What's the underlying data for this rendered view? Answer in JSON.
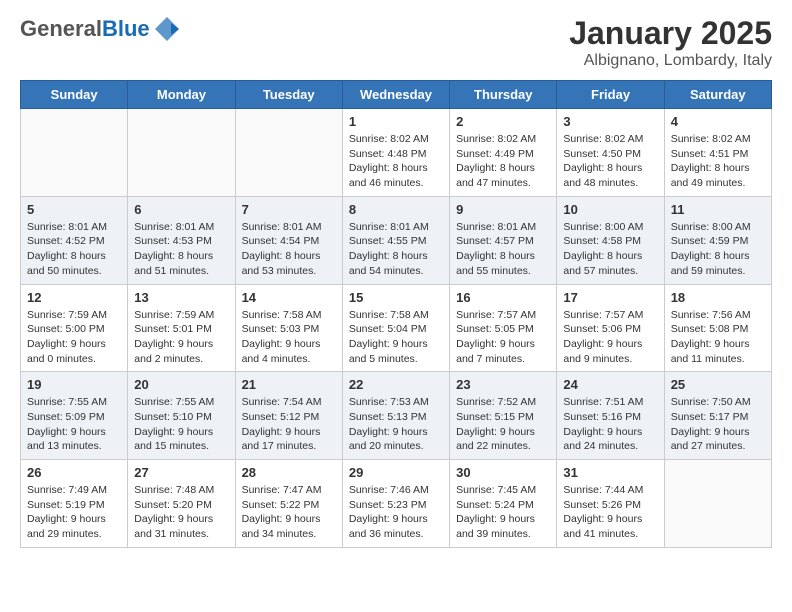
{
  "header": {
    "logo_general": "General",
    "logo_blue": "Blue",
    "month_title": "January 2025",
    "location": "Albignano, Lombardy, Italy"
  },
  "days_of_week": [
    "Sunday",
    "Monday",
    "Tuesday",
    "Wednesday",
    "Thursday",
    "Friday",
    "Saturday"
  ],
  "weeks": [
    [
      {
        "day": "",
        "info": ""
      },
      {
        "day": "",
        "info": ""
      },
      {
        "day": "",
        "info": ""
      },
      {
        "day": "1",
        "info": "Sunrise: 8:02 AM\nSunset: 4:48 PM\nDaylight: 8 hours and 46 minutes."
      },
      {
        "day": "2",
        "info": "Sunrise: 8:02 AM\nSunset: 4:49 PM\nDaylight: 8 hours and 47 minutes."
      },
      {
        "day": "3",
        "info": "Sunrise: 8:02 AM\nSunset: 4:50 PM\nDaylight: 8 hours and 48 minutes."
      },
      {
        "day": "4",
        "info": "Sunrise: 8:02 AM\nSunset: 4:51 PM\nDaylight: 8 hours and 49 minutes."
      }
    ],
    [
      {
        "day": "5",
        "info": "Sunrise: 8:01 AM\nSunset: 4:52 PM\nDaylight: 8 hours and 50 minutes."
      },
      {
        "day": "6",
        "info": "Sunrise: 8:01 AM\nSunset: 4:53 PM\nDaylight: 8 hours and 51 minutes."
      },
      {
        "day": "7",
        "info": "Sunrise: 8:01 AM\nSunset: 4:54 PM\nDaylight: 8 hours and 53 minutes."
      },
      {
        "day": "8",
        "info": "Sunrise: 8:01 AM\nSunset: 4:55 PM\nDaylight: 8 hours and 54 minutes."
      },
      {
        "day": "9",
        "info": "Sunrise: 8:01 AM\nSunset: 4:57 PM\nDaylight: 8 hours and 55 minutes."
      },
      {
        "day": "10",
        "info": "Sunrise: 8:00 AM\nSunset: 4:58 PM\nDaylight: 8 hours and 57 minutes."
      },
      {
        "day": "11",
        "info": "Sunrise: 8:00 AM\nSunset: 4:59 PM\nDaylight: 8 hours and 59 minutes."
      }
    ],
    [
      {
        "day": "12",
        "info": "Sunrise: 7:59 AM\nSunset: 5:00 PM\nDaylight: 9 hours and 0 minutes."
      },
      {
        "day": "13",
        "info": "Sunrise: 7:59 AM\nSunset: 5:01 PM\nDaylight: 9 hours and 2 minutes."
      },
      {
        "day": "14",
        "info": "Sunrise: 7:58 AM\nSunset: 5:03 PM\nDaylight: 9 hours and 4 minutes."
      },
      {
        "day": "15",
        "info": "Sunrise: 7:58 AM\nSunset: 5:04 PM\nDaylight: 9 hours and 5 minutes."
      },
      {
        "day": "16",
        "info": "Sunrise: 7:57 AM\nSunset: 5:05 PM\nDaylight: 9 hours and 7 minutes."
      },
      {
        "day": "17",
        "info": "Sunrise: 7:57 AM\nSunset: 5:06 PM\nDaylight: 9 hours and 9 minutes."
      },
      {
        "day": "18",
        "info": "Sunrise: 7:56 AM\nSunset: 5:08 PM\nDaylight: 9 hours and 11 minutes."
      }
    ],
    [
      {
        "day": "19",
        "info": "Sunrise: 7:55 AM\nSunset: 5:09 PM\nDaylight: 9 hours and 13 minutes."
      },
      {
        "day": "20",
        "info": "Sunrise: 7:55 AM\nSunset: 5:10 PM\nDaylight: 9 hours and 15 minutes."
      },
      {
        "day": "21",
        "info": "Sunrise: 7:54 AM\nSunset: 5:12 PM\nDaylight: 9 hours and 17 minutes."
      },
      {
        "day": "22",
        "info": "Sunrise: 7:53 AM\nSunset: 5:13 PM\nDaylight: 9 hours and 20 minutes."
      },
      {
        "day": "23",
        "info": "Sunrise: 7:52 AM\nSunset: 5:15 PM\nDaylight: 9 hours and 22 minutes."
      },
      {
        "day": "24",
        "info": "Sunrise: 7:51 AM\nSunset: 5:16 PM\nDaylight: 9 hours and 24 minutes."
      },
      {
        "day": "25",
        "info": "Sunrise: 7:50 AM\nSunset: 5:17 PM\nDaylight: 9 hours and 27 minutes."
      }
    ],
    [
      {
        "day": "26",
        "info": "Sunrise: 7:49 AM\nSunset: 5:19 PM\nDaylight: 9 hours and 29 minutes."
      },
      {
        "day": "27",
        "info": "Sunrise: 7:48 AM\nSunset: 5:20 PM\nDaylight: 9 hours and 31 minutes."
      },
      {
        "day": "28",
        "info": "Sunrise: 7:47 AM\nSunset: 5:22 PM\nDaylight: 9 hours and 34 minutes."
      },
      {
        "day": "29",
        "info": "Sunrise: 7:46 AM\nSunset: 5:23 PM\nDaylight: 9 hours and 36 minutes."
      },
      {
        "day": "30",
        "info": "Sunrise: 7:45 AM\nSunset: 5:24 PM\nDaylight: 9 hours and 39 minutes."
      },
      {
        "day": "31",
        "info": "Sunrise: 7:44 AM\nSunset: 5:26 PM\nDaylight: 9 hours and 41 minutes."
      },
      {
        "day": "",
        "info": ""
      }
    ]
  ]
}
